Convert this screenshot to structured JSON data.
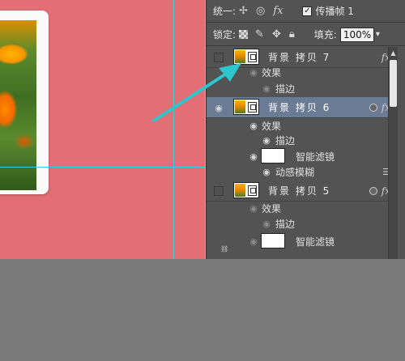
{
  "panel": {
    "unify_label": "统一:",
    "unify_icons": [
      "pin-position-icon",
      "visibility-link-icon",
      "fx-style-icon"
    ],
    "propagate_label": "传播帧 1",
    "propagate_checked": true,
    "lock_label": "锁定:",
    "fill_label": "填充:",
    "fill_value": "100%"
  },
  "layers": [
    {
      "name": "背景 拷贝 7",
      "visible": false,
      "fx": "fx",
      "effects_label": "效果",
      "effects": [
        "描边"
      ]
    },
    {
      "name": "背景 拷贝 6",
      "visible": true,
      "selected": true,
      "fx": "fx",
      "effects_label": "效果",
      "effects": [
        "描边"
      ],
      "smart_filters_label": "智能滤镜",
      "filters": [
        "动感模糊"
      ]
    },
    {
      "name": "背景 拷贝 5",
      "visible": false,
      "fx": "fx",
      "effects_label": "效果",
      "effects": [
        "描边"
      ],
      "smart_filters_label": "智能滤镜"
    }
  ],
  "colors": {
    "canvas_background": "#e46e76",
    "guide": "#2fd2dc",
    "arrow": "#2cc6cc",
    "panel_background": "#535353",
    "selected_layer": "#6b7b93"
  }
}
